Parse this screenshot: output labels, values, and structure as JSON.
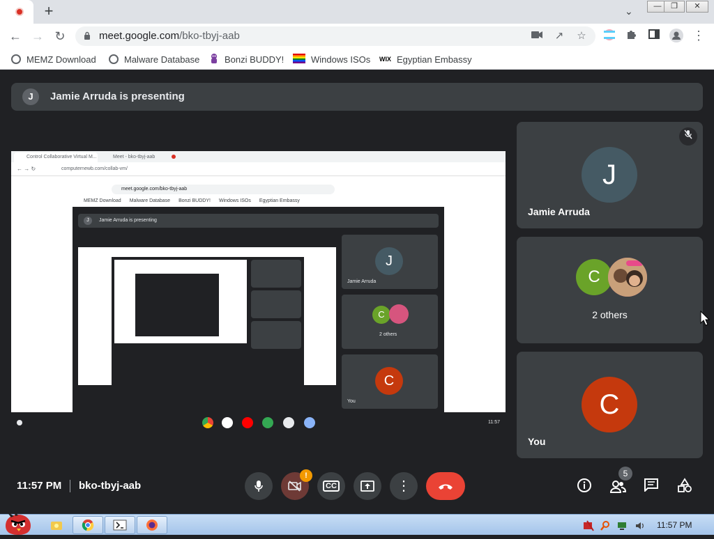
{
  "colors": {
    "accent_red": "#ea4335",
    "tile_bg": "#3c4043",
    "meet_bg": "#202124",
    "avatar_j": "#455a64",
    "avatar_c_self": "#c5390d",
    "avatar_c_green": "#6aa329"
  },
  "browser": {
    "new_tab_label": "+",
    "url_host": "meet.google.com",
    "url_path": "/bko-tbyj-aab",
    "bookmarks": [
      {
        "label": "MEMZ Download",
        "icon": "globe-icon"
      },
      {
        "label": "Malware Database",
        "icon": "globe-icon"
      },
      {
        "label": "Bonzi BUDDY!",
        "icon": "bonzi-icon"
      },
      {
        "label": "Windows ISOs",
        "icon": "rainbow-flag-icon"
      },
      {
        "label": "Egyptian Embassy",
        "icon": "wix-icon"
      }
    ],
    "wix_text": "WIX"
  },
  "presenting": {
    "avatar": "J",
    "text": "Jamie Arruda is presenting"
  },
  "shared_screen": {
    "tab1": "Control Collaborative Virtual M...",
    "tab2": "Meet - bko-tbyj-aab",
    "url": "computernewb.com/collab-vm/",
    "inner_url": "meet.google.com/bko-tbyj-aab",
    "inner_bookmarks": [
      "MEMZ Download",
      "Malware Database",
      "Bonzi BUDDY!",
      "Windows ISOs",
      "Egyptian Embassy"
    ],
    "inner_presenting": "Jamie Arruda is presenting",
    "inner_tiles": [
      {
        "avatar": "J",
        "name": "Jamie Arruda"
      },
      {
        "avatar": "C",
        "name": "2 others"
      },
      {
        "avatar": "C",
        "name": "You"
      }
    ],
    "clock": "11:57"
  },
  "tiles": [
    {
      "avatar": "J",
      "name": "Jamie Arruda"
    },
    {
      "avatar": "C",
      "name": "2 others"
    },
    {
      "avatar": "C",
      "name": "You"
    }
  ],
  "controls": {
    "time": "11:57 PM",
    "code": "bko-tbyj-aab",
    "camera_alert": "!",
    "captions_label": "CC",
    "participants_count": "5"
  },
  "taskbar": {
    "clock": "11:57 PM"
  }
}
